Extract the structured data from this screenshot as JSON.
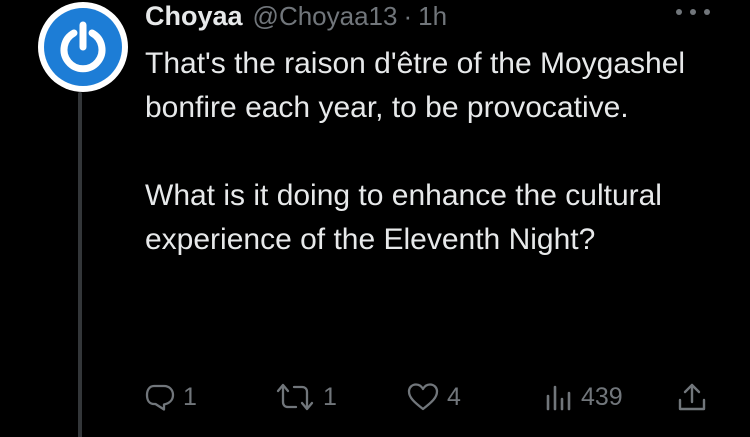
{
  "tweet": {
    "author": {
      "display_name": "Choyaa",
      "handle": "@Choyaa13",
      "separator": "·",
      "time": "1h"
    },
    "body": {
      "paragraph_1": "That's the raison d'être of the Moygashel bonfire each year, to be provocative.",
      "paragraph_2": "What is it doing to enhance the cultural experience of the Eleventh Night?"
    },
    "actions": {
      "replies": "1",
      "retweets": "1",
      "likes": "4",
      "views": "439"
    },
    "icons": {
      "avatar": "power-symbol-avatar",
      "more": "ellipsis-icon",
      "reply": "reply-icon",
      "retweet": "retweet-icon",
      "like": "heart-icon",
      "views": "views-chart-icon",
      "share": "share-icon"
    },
    "colors": {
      "background": "#000000",
      "text": "#e7e9ea",
      "muted": "#71767b",
      "avatar_blue": "#1d7dd6",
      "thread_line": "#333639"
    }
  }
}
